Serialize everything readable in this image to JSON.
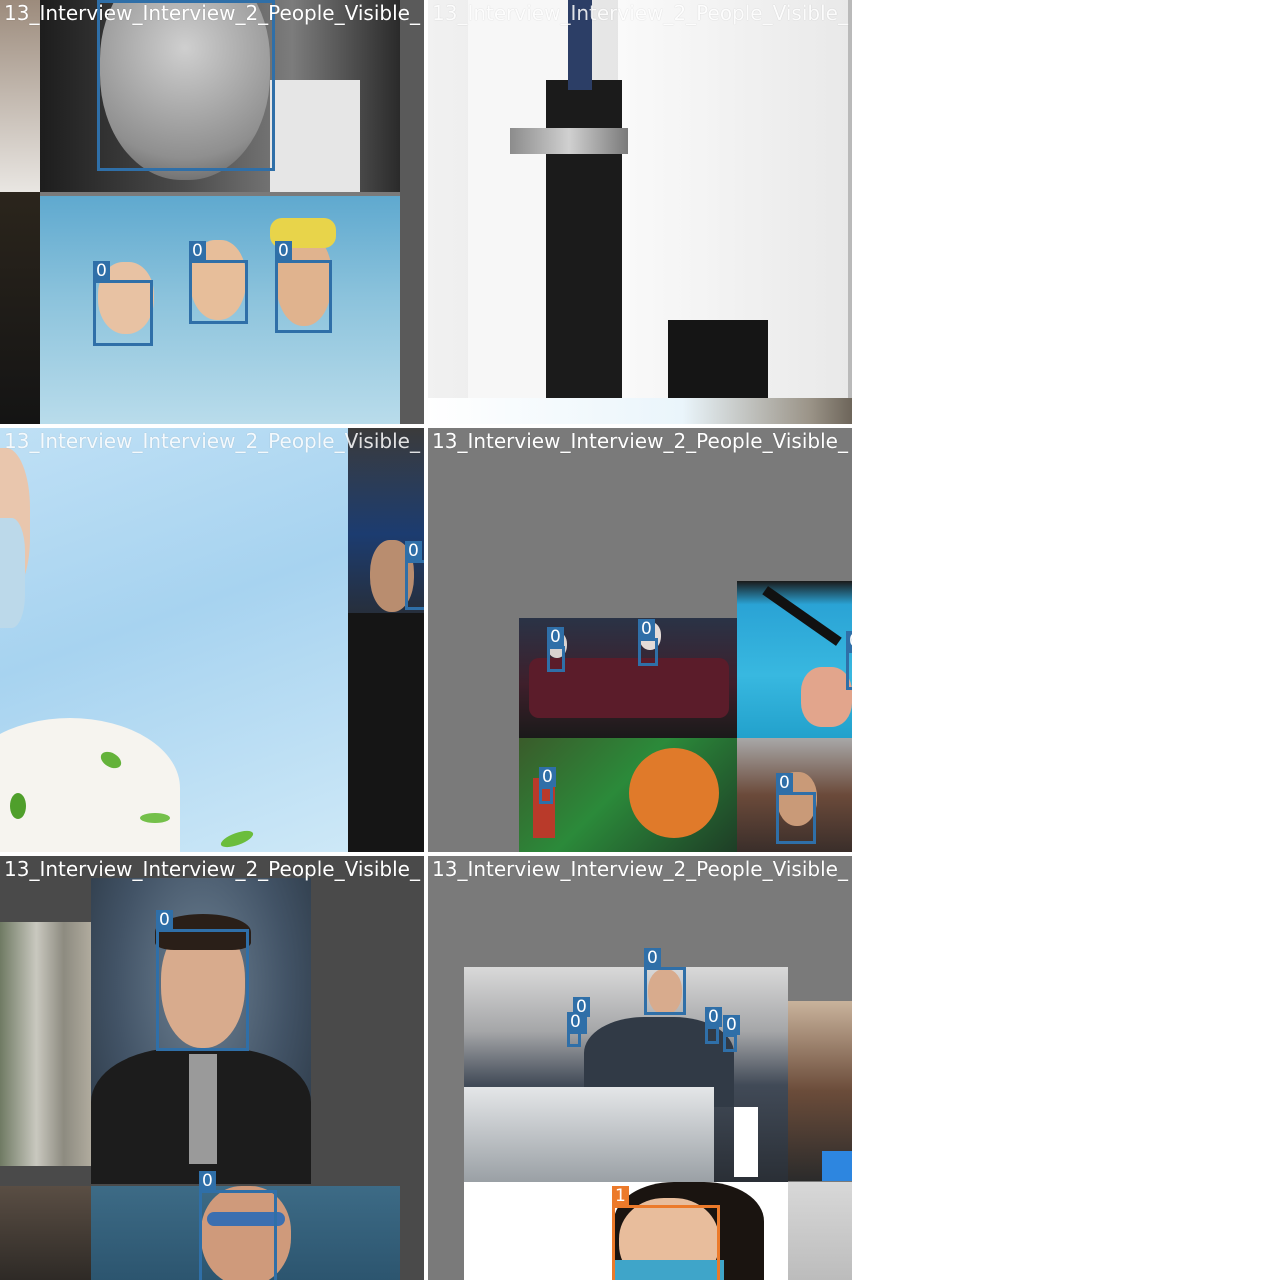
{
  "tiles": [
    {
      "title": "13_Interview_Interview_2_People_Visible_",
      "boxes": [
        {
          "label": "0"
        },
        {
          "label": "0"
        },
        {
          "label": "0"
        },
        {
          "label": "0"
        }
      ]
    },
    {
      "title": "13_Interview_Interview_2_People_Visible_",
      "boxes": []
    },
    {
      "title": "13_Interview_Interview_2_People_Visible_",
      "boxes": [
        {
          "label": "0"
        }
      ]
    },
    {
      "title": "13_Interview_Interview_2_People_Visible_",
      "boxes": [
        {
          "label": "0"
        },
        {
          "label": "0"
        },
        {
          "label": "0"
        },
        {
          "label": "0"
        },
        {
          "label": "0"
        }
      ]
    },
    {
      "title": "13_Interview_Interview_2_People_Visible_",
      "boxes": [
        {
          "label": "0"
        },
        {
          "label": "0"
        }
      ]
    },
    {
      "title": "13_Interview_Interview_2_People_Visible_",
      "boxes": [
        {
          "label": "0"
        },
        {
          "label": "0"
        },
        {
          "label": "0"
        },
        {
          "label": "0"
        },
        {
          "label": "0"
        },
        {
          "label": "1"
        }
      ]
    }
  ],
  "colors": {
    "class0_box": "#2f6fa8",
    "class1_box": "#ec7a2a",
    "mosaic_fill": "#7a7a7a"
  }
}
